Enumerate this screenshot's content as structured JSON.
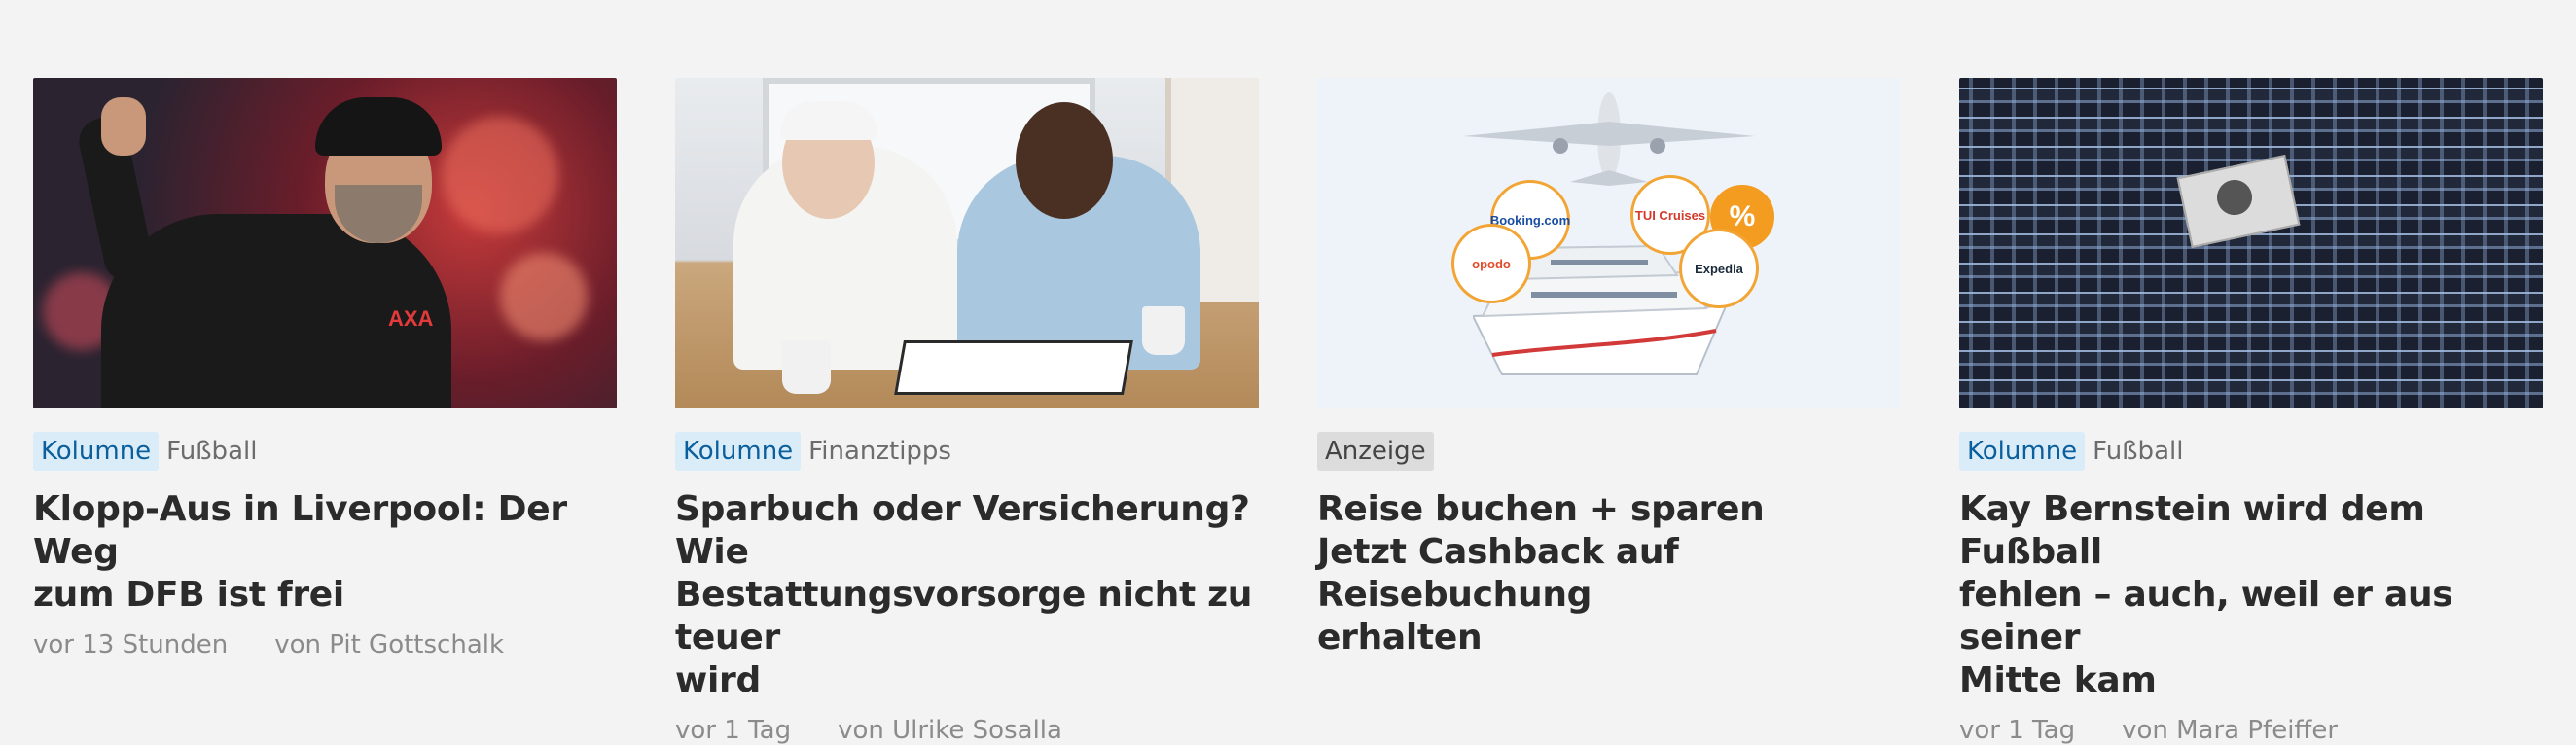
{
  "cards": [
    {
      "image_alt": "Jürgen Klopp",
      "badge": "Kolumne",
      "badge_type": "kolumne",
      "category": "Fußball",
      "title_lines": [
        "Klopp-Aus in Liverpool: Der Weg",
        "zum DFB ist frei"
      ],
      "time": "vor 13 Stunden",
      "author": "von Pit Gottschalk"
    },
    {
      "image_alt": "Beratungsgespräch",
      "badge": "Kolumne",
      "badge_type": "kolumne",
      "category": "Finanztipps",
      "title_lines": [
        "Sparbuch oder Versicherung? Wie",
        "Bestattungsvorsorge nicht zu teuer",
        "wird"
      ],
      "time": "vor 1 Tag",
      "author": "von Ulrike Sosalla"
    },
    {
      "image_alt": "Reiseangebote",
      "badge": "Anzeige",
      "badge_type": "anzeige",
      "category": "",
      "title_lines": [
        "Reise buchen + sparen",
        "Jetzt Cashback auf Reisebuchung",
        "erhalten"
      ],
      "time": "",
      "author": "",
      "logos": [
        "Booking.com",
        "TUI Cruises",
        "opodo",
        "Expedia",
        "%"
      ]
    },
    {
      "image_alt": "Fußballfans mit Schals",
      "badge": "Kolumne",
      "badge_type": "kolumne",
      "category": "Fußball",
      "title_lines": [
        "Kay Bernstein wird dem Fußball",
        "fehlen – auch, weil er aus seiner",
        "Mitte kam"
      ],
      "time": "vor 1 Tag",
      "author": "von Mara Pfeiffer"
    }
  ],
  "colors": {
    "background": "#f3f3f3",
    "kolumne_badge_bg": "#d9ecf8",
    "kolumne_badge_text": "#0b5f9c",
    "anzeige_badge_bg": "#dcdcdc",
    "title": "#2b2b2b",
    "byline": "#8b8b8b"
  }
}
